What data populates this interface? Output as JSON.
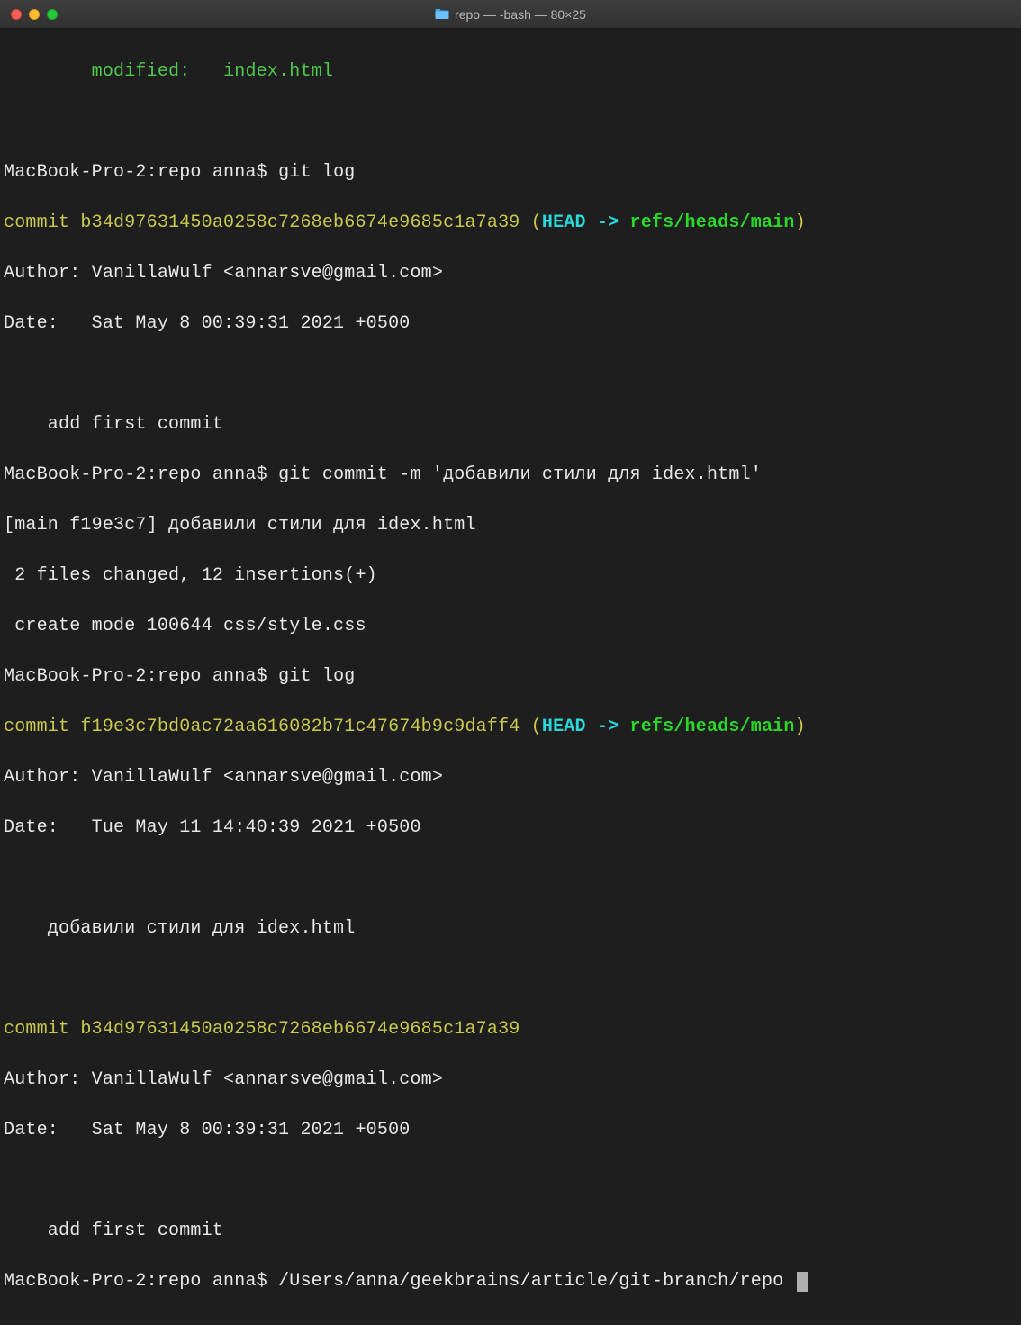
{
  "titlebar": {
    "title": "repo — -bash — 80×25"
  },
  "terminal": {
    "modified_label": "modified:",
    "modified_file": "index.html",
    "prompt": "MacBook-Pro-2:repo anna$",
    "cmd_gitlog": "git log",
    "cmd_gitcommit": "git commit -m 'добавили стили для idex.html'",
    "path_line": "/Users/anna/geekbrains/article/git-branch/repo",
    "commit1": {
      "hash_line": "commit b34d97631450a0258c7268eb6674e9685c1a7a39",
      "head_open": " (",
      "head": "HEAD -> ",
      "ref": "refs/heads/main",
      "head_close": ")",
      "author": "Author: VanillaWulf <annarsve@gmail.com>",
      "date": "Date:   Sat May 8 00:39:31 2021 +0500",
      "msg": "    add first commit"
    },
    "commit_result": {
      "line1": "[main f19e3c7] добавили стили для idex.html",
      "line2": " 2 files changed, 12 insertions(+)",
      "line3": " create mode 100644 css/style.css"
    },
    "commit2": {
      "hash_line": "commit f19e3c7bd0ac72aa616082b71c47674b9c9daff4",
      "head_open": " (",
      "head": "HEAD -> ",
      "ref": "refs/heads/main",
      "head_close": ")",
      "author": "Author: VanillaWulf <annarsve@gmail.com>",
      "date": "Date:   Tue May 11 14:40:39 2021 +0500",
      "msg": "    добавили стили для idex.html"
    },
    "commit3": {
      "hash_line": "commit b34d97631450a0258c7268eb6674e9685c1a7a39",
      "author": "Author: VanillaWulf <annarsve@gmail.com>",
      "date": "Date:   Sat May 8 00:39:31 2021 +0500",
      "msg": "    add first commit"
    }
  }
}
